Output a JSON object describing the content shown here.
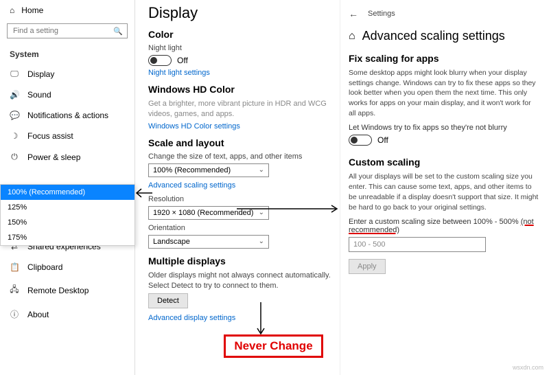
{
  "left": {
    "home": "Home",
    "search_placeholder": "Find a setting",
    "section": "System",
    "nav": [
      {
        "icon": "🖵",
        "label": "Display"
      },
      {
        "icon": "🔊",
        "label": "Sound"
      },
      {
        "icon": "💬",
        "label": "Notifications & actions"
      },
      {
        "icon": "☽",
        "label": "Focus assist"
      },
      {
        "icon": "⏻",
        "label": "Power & sleep"
      }
    ],
    "nav2": [
      {
        "icon": "⇄",
        "label": "Shared experiences"
      },
      {
        "icon": "📋",
        "label": "Clipboard"
      },
      {
        "icon": "🖧",
        "label": "Remote Desktop"
      },
      {
        "icon": "ⓘ",
        "label": "About"
      }
    ],
    "dropdown_options": [
      "100% (Recommended)",
      "125%",
      "150%",
      "175%"
    ]
  },
  "display": {
    "title": "Display",
    "color_h": "Color",
    "night_light_label": "Night light",
    "night_light_state": "Off",
    "night_light_link": "Night light settings",
    "hd_h": "Windows HD Color",
    "hd_descr": "Get a brighter, more vibrant picture in HDR and WCG videos, games, and apps.",
    "hd_link": "Windows HD Color settings",
    "scale_h": "Scale and layout",
    "scale_label": "Change the size of text, apps, and other items",
    "scale_value": "100% (Recommended)",
    "adv_scaling_link": "Advanced scaling settings",
    "resolution_label": "Resolution",
    "resolution_value": "1920 × 1080 (Recommended)",
    "orientation_label": "Orientation",
    "orientation_value": "Landscape",
    "multi_h": "Multiple displays",
    "multi_descr": "Older displays might not always connect automatically. Select Detect to try to connect to them.",
    "detect_btn": "Detect",
    "adv_display_link": "Advanced display settings"
  },
  "right": {
    "back_icon": "←",
    "header": "Settings",
    "home_icon": "⌂",
    "title": "Advanced scaling settings",
    "fix_h": "Fix scaling for apps",
    "fix_descr": "Some desktop apps might look blurry when your display settings change. Windows can try to fix these apps so they look better when you open them the next time. This only works for apps on your main display, and it won't work for all apps.",
    "fix_toggle_label": "Let Windows try to fix apps so they're not blurry",
    "fix_toggle_state": "Off",
    "custom_h": "Custom scaling",
    "custom_descr": "All your displays will be set to the custom scaling size you enter. This can cause some text, apps, and other items to be unreadable if a display doesn't support that size. It might be hard to go back to your original settings.",
    "custom_label_a": "Enter a custom scaling size between 100% - 500% ",
    "custom_label_b": "(not recommended)",
    "custom_placeholder": "100 - 500",
    "apply_btn": "Apply"
  },
  "annotations": {
    "never_change": "Never Change",
    "watermark": "wsxdn.com"
  }
}
